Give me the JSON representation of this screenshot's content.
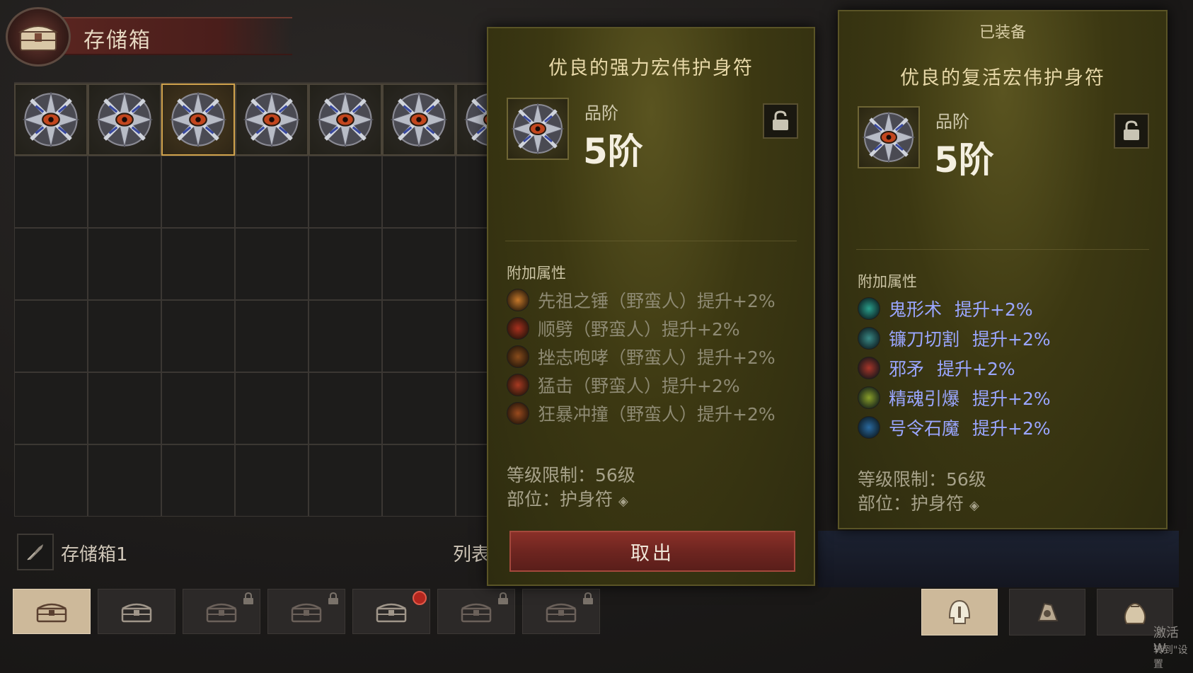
{
  "header": {
    "title": "存储箱"
  },
  "grid": {
    "columns": 7,
    "rows": 6,
    "filled_slots": 7,
    "selected_slot": 3
  },
  "bottom": {
    "chest_name": "存储箱1",
    "list_label": "列表"
  },
  "tabs": [
    {
      "name": "stash-tab-1",
      "active": true,
      "locked": false
    },
    {
      "name": "stash-tab-2",
      "active": false,
      "locked": false
    },
    {
      "name": "stash-tab-3",
      "active": false,
      "locked": true
    },
    {
      "name": "stash-tab-4",
      "active": false,
      "locked": true
    },
    {
      "name": "stash-tab-5",
      "active": false,
      "locked": false,
      "badge": true
    },
    {
      "name": "stash-tab-6",
      "active": false,
      "locked": true
    },
    {
      "name": "stash-tab-7",
      "active": false,
      "locked": true
    }
  ],
  "right_tabs": [
    "helmet-icon",
    "gem-pouch-icon",
    "bag-icon"
  ],
  "tooltip_left": {
    "title": "优良的强力宏伟护身符",
    "grade_label": "品阶",
    "grade": "5阶",
    "affix_header": "附加属性",
    "affixes": [
      {
        "text": "先祖之锤（野蛮人）提升+2%",
        "icon_color": "#c6782a"
      },
      {
        "text": "顺劈（野蛮人）提升+2%",
        "icon_color": "#a8301e"
      },
      {
        "text": "挫志咆哮（野蛮人）提升+2%",
        "icon_color": "#8a4c1c"
      },
      {
        "text": "猛击（野蛮人）提升+2%",
        "icon_color": "#a83a22"
      },
      {
        "text": "狂暴冲撞（野蛮人）提升+2%",
        "icon_color": "#9a4a1e"
      }
    ],
    "level_req": "等级限制：56级",
    "slot": "部位：护身符",
    "cancel_label": "取出"
  },
  "tooltip_right": {
    "equipped_label": "已装备",
    "title": "优良的复活宏伟护身符",
    "grade_label": "品阶",
    "grade": "5阶",
    "affix_header": "附加属性",
    "affixes": [
      {
        "name": "鬼形术",
        "value": "提升+2%",
        "icon_color": "#2aa08c"
      },
      {
        "name": "镰刀切割",
        "value": "提升+2%",
        "icon_color": "#3a8a86"
      },
      {
        "name": "邪矛",
        "value": "提升+2%",
        "icon_color": "#a8362a"
      },
      {
        "name": "精魂引爆",
        "value": "提升+2%",
        "icon_color": "#8aa02a"
      },
      {
        "name": "号令石魔",
        "value": "提升+2%",
        "icon_color": "#2a6aa0"
      }
    ],
    "level_req": "等级限制：56级",
    "slot": "部位：护身符"
  },
  "watermark": {
    "line1": "激活 W",
    "line2": "转到\"设置"
  },
  "colors": {
    "affix_gray": "#8e8a73",
    "affix_blue": "#9aa6ff",
    "selected_border": "#d0a24c",
    "cancel_button": "#7a2a24"
  }
}
